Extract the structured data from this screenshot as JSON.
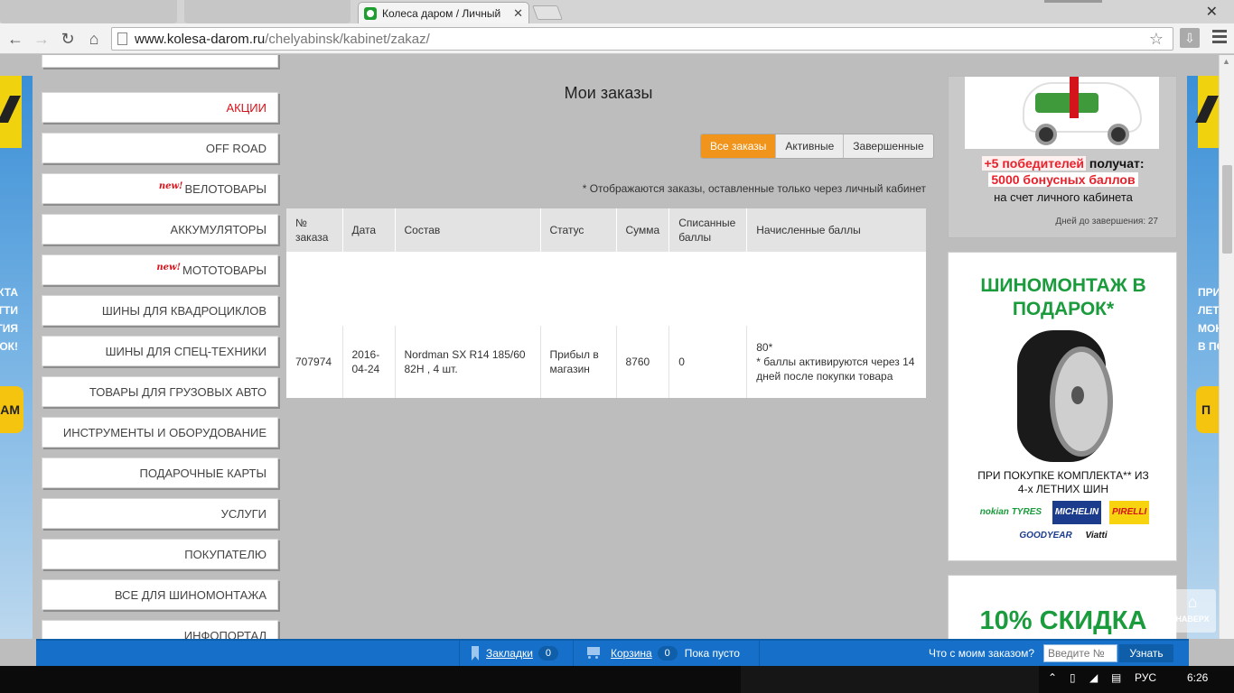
{
  "browser": {
    "tab_title": "Колеса даром / Личный",
    "tab_close": "✕",
    "window_close": "✕",
    "url_host": "www.kolesa-darom.ru",
    "url_path": "/chelyabinsk/kabinet/zakaz/"
  },
  "side_left": {
    "lines": [
      "КТА",
      "АТТИ",
      "ТИЯ",
      "ОК!"
    ],
    "button": "АМ"
  },
  "side_right": {
    "lines": [
      "ПРИ",
      "ЛЕТ",
      "МОН",
      "В ПО"
    ],
    "button": "П"
  },
  "menu": [
    {
      "label": "АКЦИИ",
      "red": true,
      "new": false
    },
    {
      "label": "OFF ROAD",
      "red": false,
      "new": false
    },
    {
      "label": "ВЕЛОТОВАРЫ",
      "red": false,
      "new": true
    },
    {
      "label": "АККУМУЛЯТОРЫ",
      "red": false,
      "new": false
    },
    {
      "label": "МОТОТОВАРЫ",
      "red": false,
      "new": true
    },
    {
      "label": "ШИНЫ ДЛЯ КВАДРОЦИКЛОВ",
      "red": false,
      "new": false
    },
    {
      "label": "ШИНЫ ДЛЯ СПЕЦ-ТЕХНИКИ",
      "red": false,
      "new": false
    },
    {
      "label": "ТОВАРЫ ДЛЯ ГРУЗОВЫХ АВТО",
      "red": false,
      "new": false
    },
    {
      "label": "ИНСТРУМЕНТЫ И ОБОРУДОВАНИЕ",
      "red": false,
      "new": false
    },
    {
      "label": "ПОДАРОЧНЫЕ КАРТЫ",
      "red": false,
      "new": false
    },
    {
      "label": "УСЛУГИ",
      "red": false,
      "new": false
    },
    {
      "label": "ПОКУПАТЕЛЮ",
      "red": false,
      "new": false
    },
    {
      "label": "ВСЕ ДЛЯ ШИНОМОНТАЖА",
      "red": false,
      "new": false
    },
    {
      "label": "ИНФОПОРТАЛ",
      "red": false,
      "new": false
    }
  ],
  "new_badge": "new!",
  "main": {
    "title": "Мои заказы",
    "filters": [
      "Все заказы",
      "Активные",
      "Завершенные"
    ],
    "active_filter": 0,
    "note": "* Отображаются заказы, оставленные только через личный кабинет",
    "table": {
      "headers": [
        "№ заказа",
        "Дата",
        "Состав",
        "Статус",
        "Сумма",
        "Списанные баллы",
        "Начисленные баллы"
      ],
      "rows": [
        [
          "707974",
          "2016-04-24",
          "Nordman SX R14 185/60 82H , 4 шт.",
          "Прибыл в магазин",
          "8760",
          "0",
          "80*\n* баллы активируются через 14 дней после покупки товара"
        ]
      ]
    }
  },
  "ads": {
    "promo1": {
      "line1_red": "+5 победителей",
      "line1_black": "получат:",
      "line2": "5000 бонусных баллов",
      "line3": "на счет личного кабинета",
      "days": "Дней до завершения: 27"
    },
    "promo2": {
      "headline": "ШИНОМОНТАЖ В ПОДАРОК*",
      "text": "ПРИ ПОКУПКЕ КОМПЛЕКТА** ИЗ 4-х ЛЕТНИХ ШИН",
      "brands": [
        "nokian TYRES",
        "MICHELIN",
        "PIRELLI",
        "GOODYEAR",
        "Viatti"
      ]
    },
    "promo3": {
      "headline": "10% СКИДКА"
    }
  },
  "to_top": "НАВЕРХ",
  "bottom_bar": {
    "bookmarks_label": "Закладки",
    "bookmarks_count": "0",
    "cart_label": "Корзина",
    "cart_count": "0",
    "cart_status": "Пока пусто",
    "order_question": "Что с моим заказом?",
    "order_placeholder": "Введите №",
    "order_button": "Узнать"
  },
  "taskbar": {
    "lang": "РУС",
    "time": "6:26"
  },
  "colors": {
    "accent_orange": "#f0941b",
    "brand_green": "#1a9b3c",
    "menu_red": "#d5131b",
    "bottom_bar_blue": "#1670c9"
  }
}
